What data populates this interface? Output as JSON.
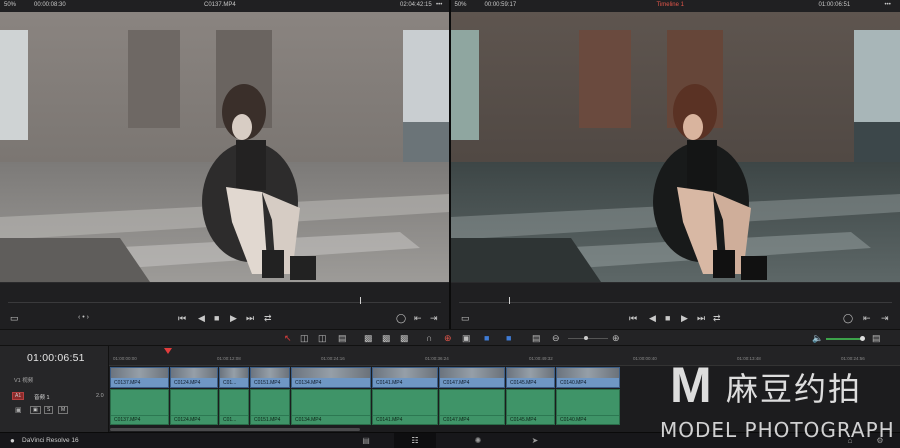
{
  "source_viewer": {
    "zoom": "50%",
    "timecode": "00:00:08:30",
    "clip_name": "C0137.MP4",
    "duration": "02:04:42:15",
    "menu": "•••"
  },
  "timeline_viewer": {
    "zoom": "50%",
    "timecode": "00:00:59:17",
    "timeline_name": "Timeline 1",
    "duration": "01:00:06:51",
    "menu": "•••"
  },
  "timeline": {
    "current_timecode": "01:00:06:51",
    "ruler_ticks": [
      "01:00:00:00",
      "01:00:12:08",
      "01:00:24:16",
      "01:00:36:24",
      "01:00:49:32",
      "01:00:00:40",
      "01:00:13:48",
      "01:00:24:56"
    ],
    "video_track_label": "V1 视频",
    "audio_track": {
      "tag": "A1",
      "name": "音频 1",
      "level": "2.0",
      "buttons": [
        "S",
        "M"
      ]
    },
    "video_clips": [
      "C0137.MP4",
      "C0124.MP4",
      "C01...",
      "C0151.MP4",
      "C0134.MP4",
      "C0141.MP4",
      "C0147.MP4",
      "C0145.MP4",
      "C0140.MP4"
    ],
    "audio_clips": [
      "C0137.MP4",
      "C0124.MP4",
      "C01...",
      "C0151.MP4",
      "C0134.MP4",
      "C0141.MP4",
      "C0147.MP4",
      "C0145.MP4",
      "C0140.MP4"
    ]
  },
  "status_bar": {
    "app_name": "DaVinci Resolve 16"
  },
  "watermark": {
    "logo_letter": "M",
    "chinese": "麻豆约拍",
    "english": "MODEL PHOTOGRAPH"
  },
  "icons": {
    "play": "▶",
    "stop": "■",
    "prev": "⏮",
    "next": "⏭",
    "step_back": "◀",
    "step_fwd": "▶",
    "loop": "⇄",
    "monitor": "▭",
    "snap": "∩",
    "link": "⊕",
    "lock": "▣",
    "speaker": "🔈",
    "arrow": "↖"
  },
  "colors": {
    "playhead": "#e23d3d",
    "video_clip": "#6f97c4",
    "audio_clip": "#3f9468",
    "timeline_name": "#e2564a"
  }
}
